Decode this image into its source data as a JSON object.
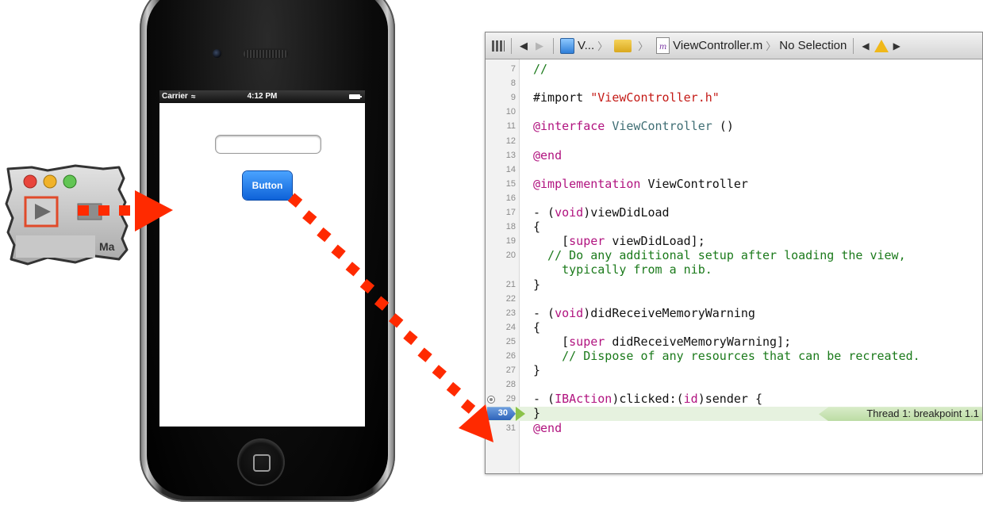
{
  "mac_snippet": {
    "tab_label_fragment": "Ma",
    "traffic_light_colors": [
      "#e8453c",
      "#f0b229",
      "#62c554"
    ]
  },
  "iphone": {
    "status": {
      "carrier": "Carrier",
      "time": "4:12 PM"
    },
    "button_label": "Button",
    "text_field_value": ""
  },
  "xcode": {
    "jumpbar": {
      "project": "V...",
      "file": "ViewController.m",
      "selection": "No Selection",
      "file_icon_letter": "m"
    },
    "lines": [
      {
        "n": "7",
        "tokens": [
          {
            "t": "//",
            "c": "cmt"
          }
        ]
      },
      {
        "n": "8",
        "tokens": []
      },
      {
        "n": "9",
        "tokens": [
          {
            "t": "#import ",
            "c": ""
          },
          {
            "t": "\"ViewController.h\"",
            "c": "str"
          }
        ]
      },
      {
        "n": "10",
        "tokens": []
      },
      {
        "n": "11",
        "tokens": [
          {
            "t": "@interface ",
            "c": "kw"
          },
          {
            "t": "ViewController",
            "c": "typ"
          },
          {
            "t": " ()",
            "c": ""
          }
        ]
      },
      {
        "n": "12",
        "tokens": []
      },
      {
        "n": "13",
        "tokens": [
          {
            "t": "@end",
            "c": "kw"
          }
        ]
      },
      {
        "n": "14",
        "tokens": []
      },
      {
        "n": "15",
        "tokens": [
          {
            "t": "@implementation ",
            "c": "kw"
          },
          {
            "t": "ViewController",
            "c": ""
          }
        ]
      },
      {
        "n": "16",
        "tokens": []
      },
      {
        "n": "17",
        "tokens": [
          {
            "t": "- (",
            "c": ""
          },
          {
            "t": "void",
            "c": "kw"
          },
          {
            "t": ")viewDidLoad",
            "c": ""
          }
        ]
      },
      {
        "n": "18",
        "tokens": [
          {
            "t": "{",
            "c": ""
          }
        ]
      },
      {
        "n": "19",
        "tokens": [
          {
            "t": "    [",
            "c": ""
          },
          {
            "t": "super",
            "c": "kw"
          },
          {
            "t": " viewDidLoad];",
            "c": ""
          }
        ]
      },
      {
        "n": "20",
        "tokens": [
          {
            "t": "  // Do any additional setup after loading the view,",
            "c": "cmt"
          }
        ]
      },
      {
        "n": "",
        "tokens": [
          {
            "t": "    typically from a nib.",
            "c": "cmt"
          }
        ]
      },
      {
        "n": "21",
        "tokens": [
          {
            "t": "}",
            "c": ""
          }
        ]
      },
      {
        "n": "22",
        "tokens": []
      },
      {
        "n": "23",
        "tokens": [
          {
            "t": "- (",
            "c": ""
          },
          {
            "t": "void",
            "c": "kw"
          },
          {
            "t": ")didReceiveMemoryWarning",
            "c": ""
          }
        ]
      },
      {
        "n": "24",
        "tokens": [
          {
            "t": "{",
            "c": ""
          }
        ]
      },
      {
        "n": "25",
        "tokens": [
          {
            "t": "    [",
            "c": ""
          },
          {
            "t": "super",
            "c": "kw"
          },
          {
            "t": " didReceiveMemoryWarning];",
            "c": ""
          }
        ]
      },
      {
        "n": "26",
        "tokens": [
          {
            "t": "    // Dispose of any resources that can be recreated.",
            "c": "cmt"
          }
        ]
      },
      {
        "n": "27",
        "tokens": [
          {
            "t": "}",
            "c": ""
          }
        ]
      },
      {
        "n": "28",
        "tokens": []
      },
      {
        "n": "29",
        "tokens": [
          {
            "t": "- (",
            "c": ""
          },
          {
            "t": "IBAction",
            "c": "kw"
          },
          {
            "t": ")clicked:(",
            "c": ""
          },
          {
            "t": "id",
            "c": "kw"
          },
          {
            "t": ")sender {",
            "c": ""
          }
        ],
        "bp_dot": true
      },
      {
        "n": "30",
        "tokens": [
          {
            "t": "}",
            "c": ""
          }
        ],
        "breakpoint": true,
        "thread_label": "Thread 1: breakpoint 1.1"
      },
      {
        "n": "31",
        "tokens": [
          {
            "t": "@end",
            "c": "kw"
          }
        ]
      }
    ]
  },
  "colors": {
    "arrow_red": "#ff2a00",
    "highlight_box": "#e04a2a"
  }
}
